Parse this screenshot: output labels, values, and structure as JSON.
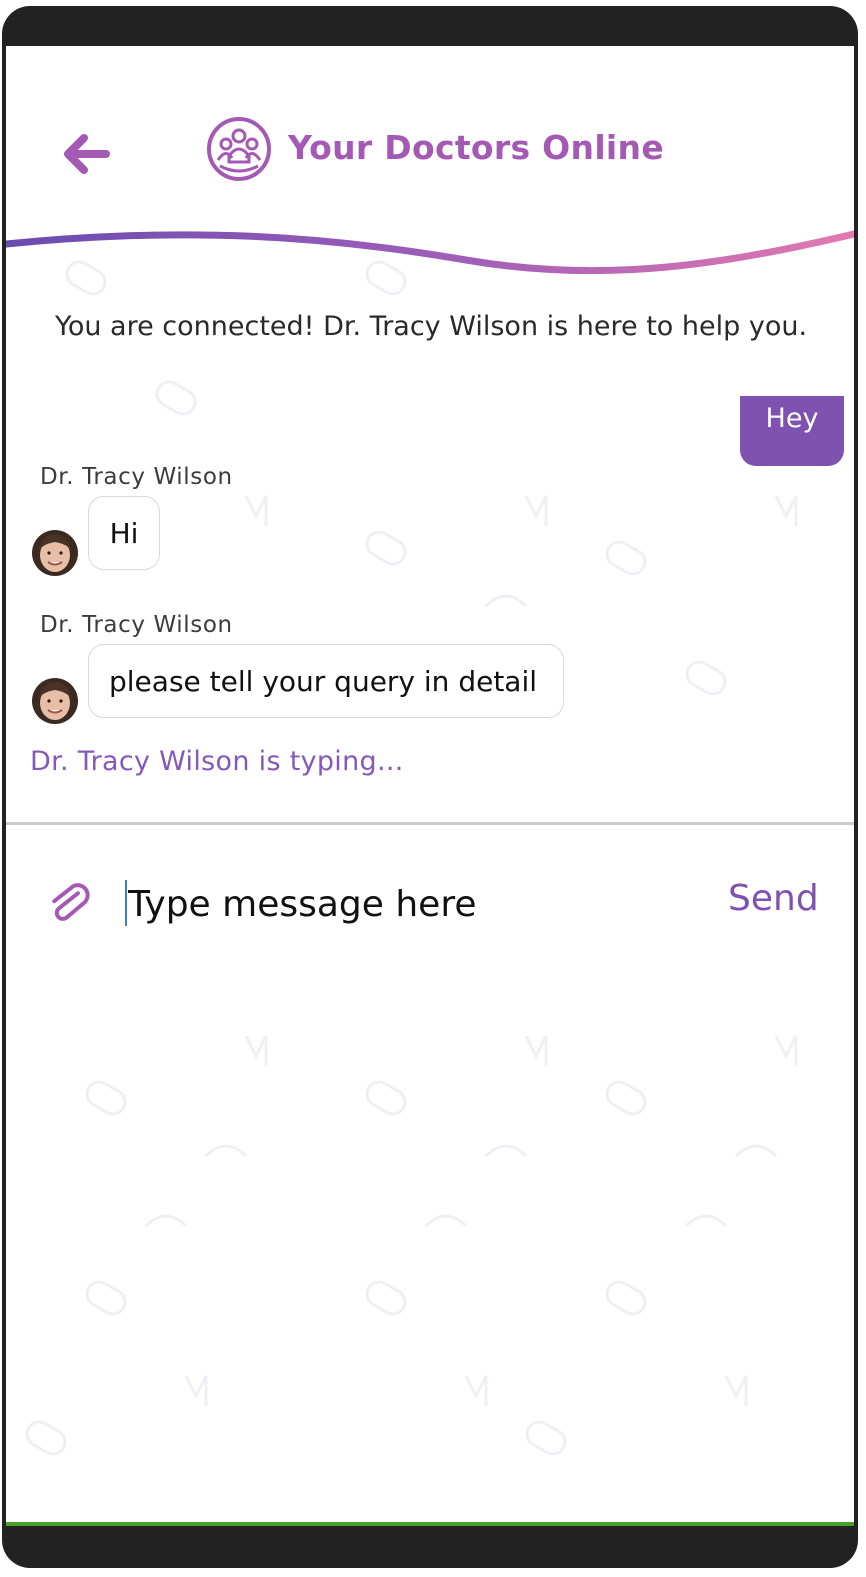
{
  "header": {
    "title": "Your Doctors Online",
    "back_icon": "arrow-left-icon",
    "logo_icon": "doctors-group-icon"
  },
  "colors": {
    "brand_purple": "#a45ab4",
    "sent_bubble": "#7f51b1",
    "typing_text": "#8459b9",
    "wave_start": "#6a4bb0",
    "wave_end": "#e27ab0"
  },
  "chat": {
    "connected_notice": "You are connected! Dr. Tracy Wilson is here to help you.",
    "messages": [
      {
        "direction": "outgoing",
        "text": "Hey"
      },
      {
        "direction": "incoming",
        "sender": "Dr. Tracy Wilson",
        "text": "Hi"
      },
      {
        "direction": "incoming",
        "sender": "Dr. Tracy Wilson",
        "text": "please tell your query in detail"
      }
    ],
    "typing_status": "Dr. Tracy Wilson is typing..."
  },
  "composer": {
    "attach_icon": "paperclip-icon",
    "placeholder": "Type message here",
    "value": "",
    "send_label": "Send"
  }
}
